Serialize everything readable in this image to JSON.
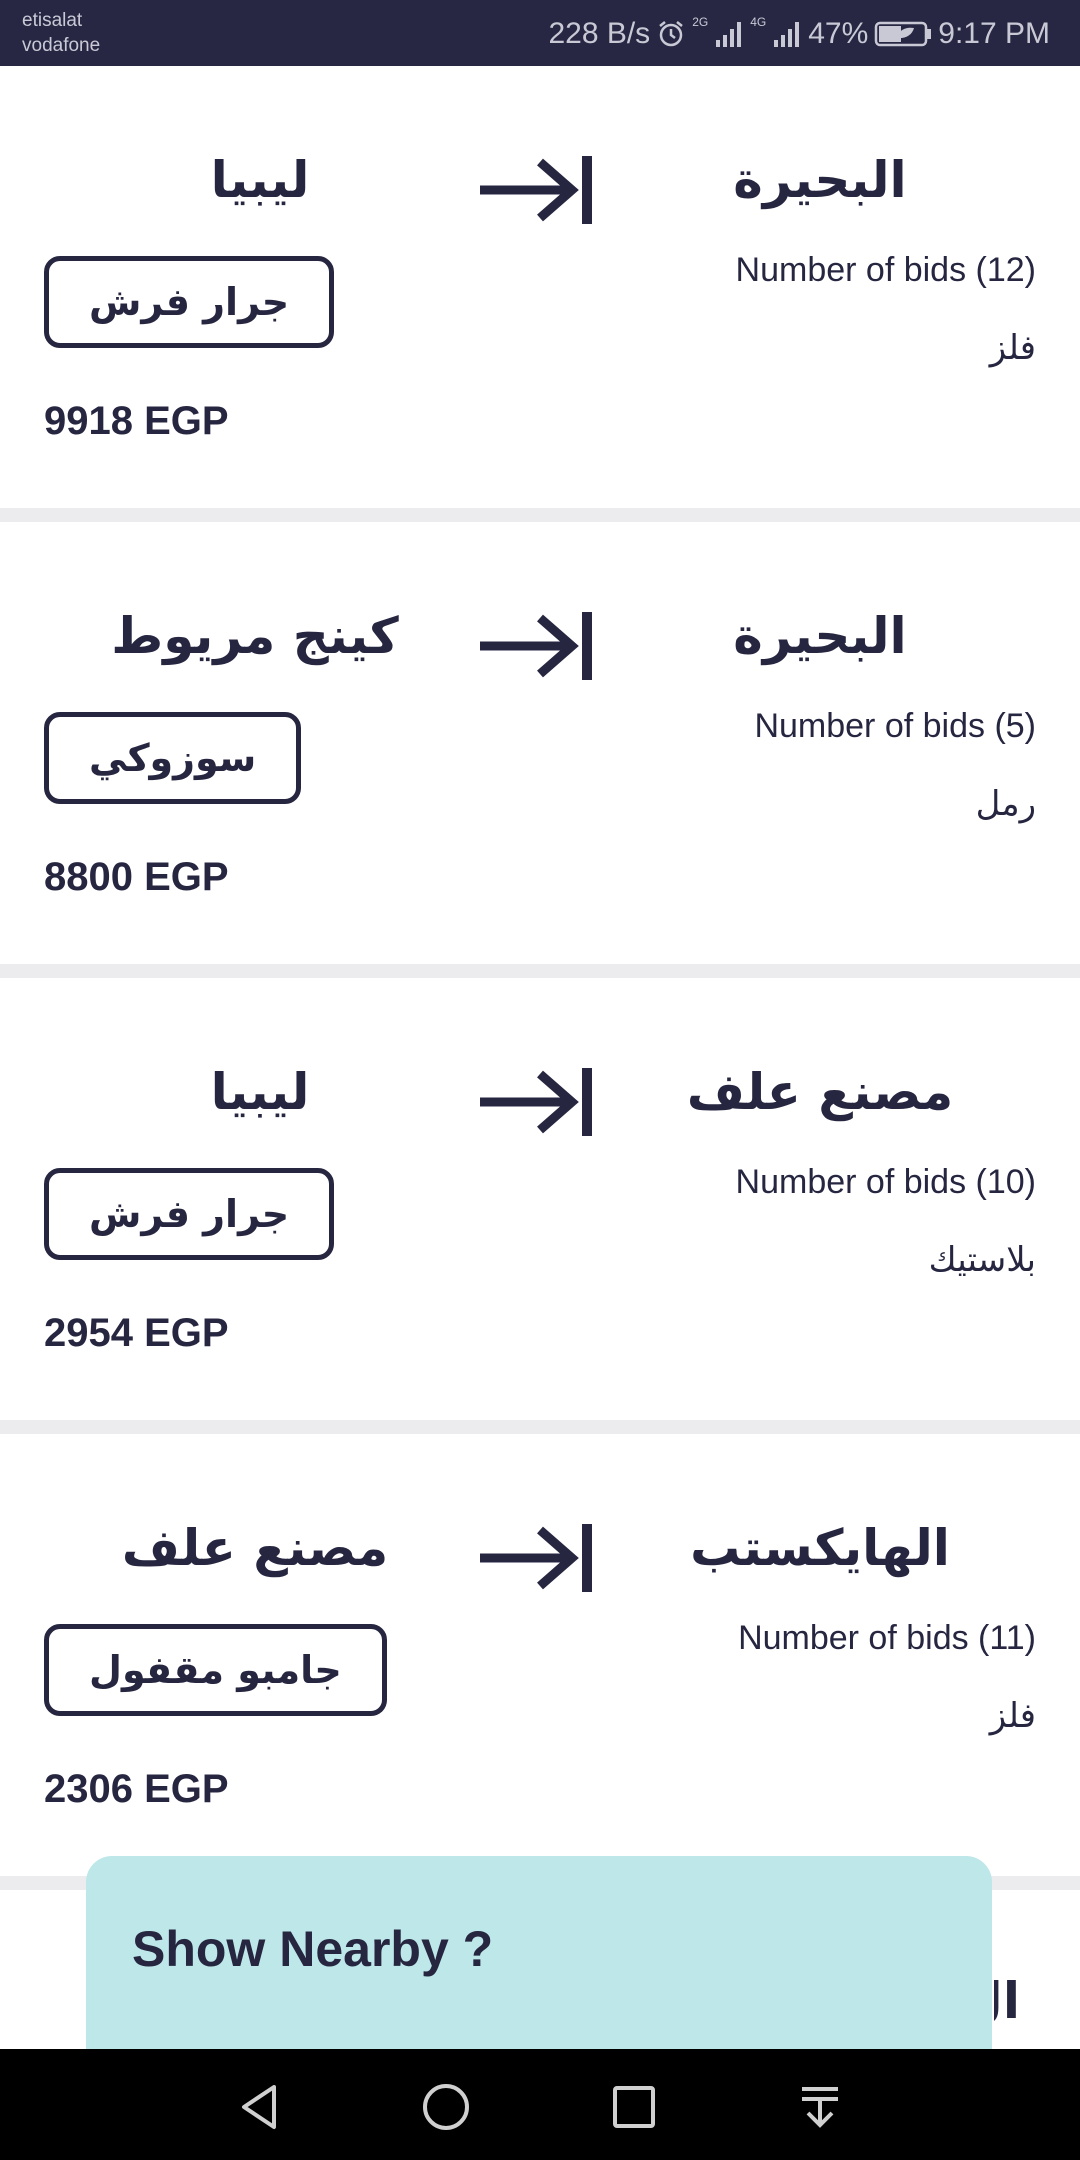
{
  "status_bar": {
    "carrier_1": "etisalat",
    "carrier_2": "vodafone",
    "net_speed": "228 B/s",
    "network_1": "2G",
    "network_2": "4G",
    "battery": "47%",
    "time": "9:17 PM",
    "icons": [
      "alarm-icon",
      "signal-icon",
      "signal-icon",
      "battery-icon"
    ]
  },
  "shipments": [
    {
      "origin": "البحيرة",
      "destination": "ليبيا",
      "bids": "Number of bids (12)",
      "material": "فلز",
      "truck": "جرار فرش",
      "price": "9918 EGP"
    },
    {
      "origin": "البحيرة",
      "destination": "كينج مريوط",
      "bids": "Number of bids (5)",
      "material": "رمل",
      "truck": "سوزوكي",
      "price": "8800 EGP"
    },
    {
      "origin": "مصنع علف",
      "destination": "ليبيا",
      "bids": "Number of bids (10)",
      "material": "بلاستيك",
      "truck": "جرار فرش",
      "price": "2954 EGP"
    },
    {
      "origin": "الهايكستب",
      "destination": "مصنع علف",
      "bids": "Number of bids (11)",
      "material": "فلز",
      "truck": "جامبو مقفول",
      "price": "2306 EGP"
    }
  ],
  "partial_card_text": "ال",
  "nearby_prompt": {
    "title": "Show Nearby ?"
  },
  "nav_bar": {
    "icons": [
      "back-icon",
      "home-icon",
      "recents-icon",
      "notification-pulldown-icon"
    ]
  },
  "colors": {
    "status_bar_bg": "#272744",
    "primary_text": "#262641",
    "divider": "#ececef",
    "nearby_bg": "#bde7e8",
    "nav_bar_bg": "#000000"
  }
}
